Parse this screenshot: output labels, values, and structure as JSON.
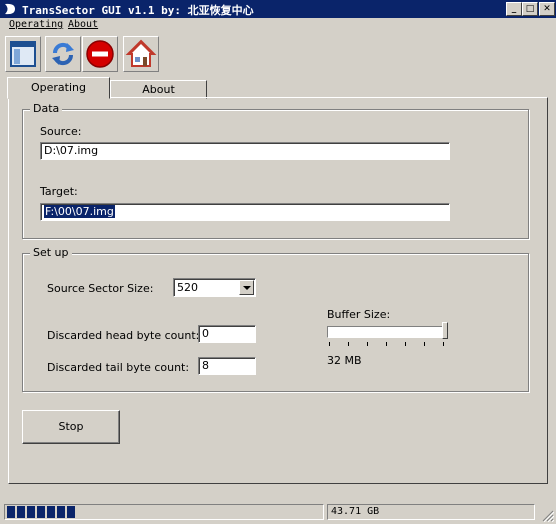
{
  "window": {
    "title": "TransSector GUI v1.1  by: 北亚恢复中心",
    "controls": {
      "minimize": "_",
      "maximize": "□",
      "close": "✕"
    }
  },
  "menu": {
    "items": [
      "Operating",
      "About"
    ]
  },
  "toolbar": {
    "buttons": [
      {
        "icon": "window-icon"
      },
      {
        "icon": "refresh-icon"
      },
      {
        "icon": "stop-icon"
      },
      {
        "icon": "home-icon"
      }
    ]
  },
  "tabs": [
    {
      "label": "Operating",
      "active": true
    },
    {
      "label": "About",
      "active": false
    }
  ],
  "data_group": {
    "title": "Data",
    "source_label": "Source:",
    "source_value": "D:\\07.img",
    "target_label": "Target:",
    "target_value": "F:\\00\\07.img"
  },
  "setup_group": {
    "title": "Set up",
    "sector_size_label": "Source Sector Size:",
    "sector_size_value": "520",
    "head_label": "Discarded head byte count:",
    "head_value": "0",
    "tail_label": "Discarded tail byte count:",
    "tail_value": "8",
    "buffer_label": "Buffer Size:",
    "buffer_value": "32 MB",
    "buffer_slider_fraction": 1.0,
    "buffer_ticks": 7
  },
  "stop_button": "Stop",
  "status": {
    "progress_blocks": 7,
    "size_text": "43.71 GB"
  },
  "colors": {
    "titlebar": "#0a246a",
    "face": "#d4d0c8",
    "selection": "#0a246a",
    "stop_red": "#d40000",
    "refresh_blue": "#3a7bd5",
    "home_red": "#c0392b"
  }
}
